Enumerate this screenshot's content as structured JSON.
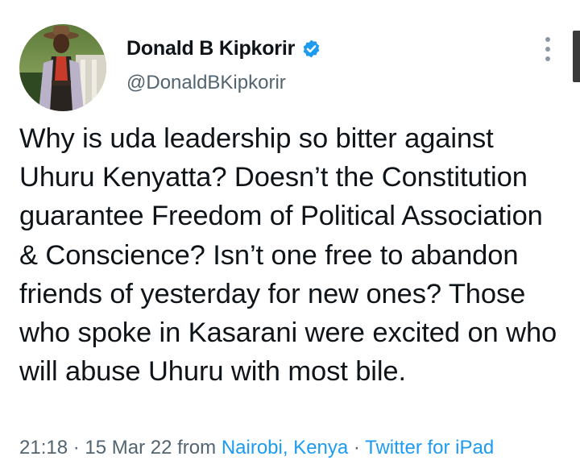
{
  "author": {
    "display_name": "Donald B Kipkorir",
    "handle": "@DonaldBKipkorir",
    "verified": true,
    "verified_color": "#1d9bf0"
  },
  "tweet": {
    "text": "Why is uda leadership so bitter against Uhuru Kenyatta? Doesn’t the Constitution guarantee Freedom of Political Association & Conscience? Isn’t one free to abandon friends of yesterday for new ones? Those who spoke in Kasarani were excited on who will abuse Uhuru with most bile."
  },
  "meta": {
    "time": "21:18",
    "separator": "·",
    "date": "15 Mar 22",
    "from_label": "from",
    "location": "Nairobi, Kenya",
    "source": "Twitter for iPad"
  },
  "colors": {
    "text": "#0f1419",
    "secondary": "#536471",
    "link": "#1d9bf0"
  }
}
